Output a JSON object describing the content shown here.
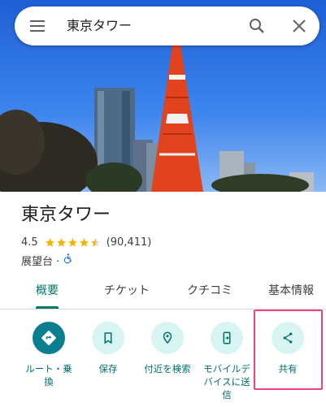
{
  "search": {
    "query": "東京タワー"
  },
  "place": {
    "name": "東京タワー",
    "rating": "4.5",
    "stars": 4.5,
    "review_count": "(90,411)",
    "category": "展望台 ·"
  },
  "tabs": [
    "概要",
    "チケット",
    "クチコミ",
    "基本情報"
  ],
  "actions": [
    {
      "label": "ルート・乗\n換",
      "icon": "directions-icon"
    },
    {
      "label": "保存",
      "icon": "bookmark-icon"
    },
    {
      "label": "付近を検索",
      "icon": "nearby-icon"
    },
    {
      "label": "モバイルデ\nバイスに送\n信",
      "icon": "send-to-phone-icon"
    },
    {
      "label": "共有",
      "icon": "share-icon"
    }
  ],
  "colors": {
    "accent": "#00796b",
    "highlight": "#f0447a",
    "stars": "#f4b400"
  }
}
